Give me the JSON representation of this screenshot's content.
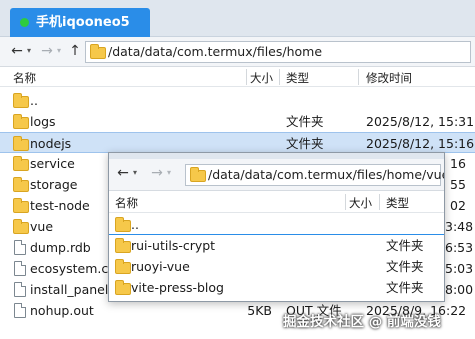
{
  "tab": {
    "title": "手机iqooneo5"
  },
  "back": {
    "path": "/data/data/com.termux/files/home",
    "columns": {
      "name": "名称",
      "size": "大小",
      "type": "类型",
      "modified": "修改时间"
    },
    "rows": [
      {
        "name": "..",
        "size": "",
        "type": "",
        "modified": "",
        "icon": "folder-icon"
      },
      {
        "name": "logs",
        "size": "",
        "type": "文件夹",
        "modified": "2025/8/12, 15:31",
        "icon": "folder-icon"
      },
      {
        "name": "nodejs",
        "size": "",
        "type": "文件夹",
        "modified": "2025/8/12, 15:16",
        "icon": "folder-icon",
        "selected": true
      },
      {
        "name": "service",
        "size": "",
        "type": "",
        "modified": "16",
        "icon": "folder-icon"
      },
      {
        "name": "storage",
        "size": "",
        "type": "",
        "modified": "55",
        "icon": "folder-icon"
      },
      {
        "name": "test-node",
        "size": "",
        "type": "",
        "modified": "02",
        "icon": "folder-icon"
      },
      {
        "name": "vue",
        "size": "",
        "type": "",
        "modified": "3:48",
        "icon": "folder-icon"
      },
      {
        "name": "dump.rdb",
        "size": "",
        "type": "",
        "modified": "6:53",
        "icon": "file-icon"
      },
      {
        "name": "ecosystem.con",
        "size": "",
        "type": "",
        "modified": "5:03",
        "icon": "file-icon"
      },
      {
        "name": "install_panel.s",
        "size": "",
        "type": "",
        "modified": "8:00",
        "icon": "file-icon"
      },
      {
        "name": "nohup.out",
        "size": "5KB",
        "type": "OUT 文件",
        "modified": "2025/8/9, 16:22",
        "icon": "file-icon"
      }
    ]
  },
  "front": {
    "path": "/data/data/com.termux/files/home/vue",
    "columns": {
      "name": "名称",
      "size": "大小",
      "type": "类型"
    },
    "rows": [
      {
        "name": "..",
        "type": ""
      },
      {
        "name": "rui-utils-crypt",
        "type": "文件夹"
      },
      {
        "name": "ruoyi-vue",
        "type": "文件夹"
      },
      {
        "name": "vite-press-blog",
        "type": "文件夹"
      }
    ]
  },
  "watermark": "掘金技术社区 @ 前端没钱",
  "colors": {
    "accent": "#2a8de8",
    "selection": "#cfe2f7",
    "folder": "#f6c84a"
  },
  "nav": {
    "back": "←",
    "forward": "→",
    "up": "↑",
    "caret": "▾"
  }
}
